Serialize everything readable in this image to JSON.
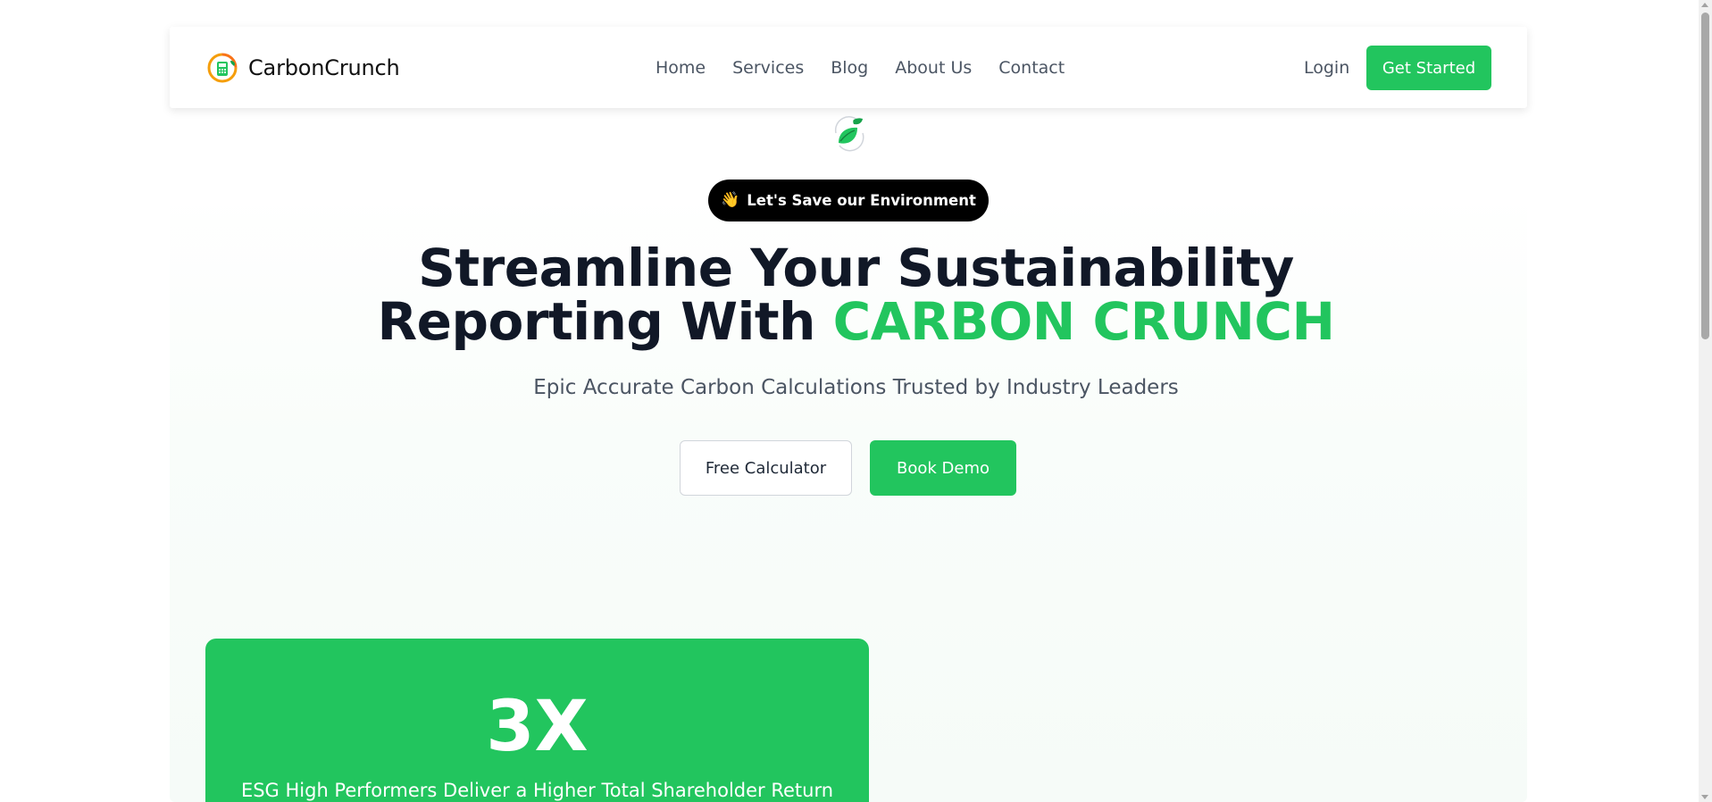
{
  "nav": {
    "brand": "CarbonCrunch",
    "links": [
      "Home",
      "Services",
      "Blog",
      "About Us",
      "Contact"
    ],
    "login": "Login",
    "get_started": "Get Started"
  },
  "hero": {
    "badge_icon": "waving-hand-icon",
    "badge_emoji": "👋",
    "badge_text": "Let's Save our Environment",
    "headline_line1": "Streamline Your Sustainability",
    "headline_line2_prefix": "Reporting With",
    "headline_highlight": "CARBON CRUNCH",
    "subtitle": "Epic Accurate Carbon Calculations Trusted by Industry Leaders",
    "btn_calculator": "Free Calculator",
    "btn_demo": "Book Demo"
  },
  "stat": {
    "value": "3X",
    "caption": "ESG High Performers Deliver a Higher Total Shareholder Return"
  },
  "colors": {
    "accent": "#22c55e",
    "heading": "#111827",
    "muted_text": "#4b5563",
    "badge_bg": "#000000"
  }
}
